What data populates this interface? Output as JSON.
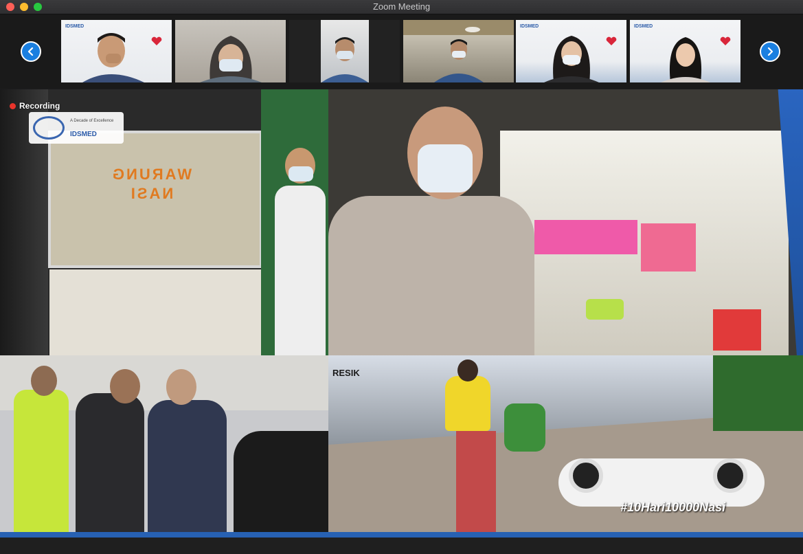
{
  "window": {
    "title": "Zoom Meeting"
  },
  "gallery": {
    "prev_icon": "chevron-left-icon",
    "next_icon": "chevron-right-icon",
    "thumbnails": [
      {
        "name": "participant-1",
        "logo": "IDSMED"
      },
      {
        "name": "participant-2",
        "logo": ""
      },
      {
        "name": "participant-3",
        "logo": ""
      },
      {
        "name": "participant-4",
        "logo": ""
      },
      {
        "name": "participant-5",
        "logo": "IDSMED"
      },
      {
        "name": "participant-6",
        "logo": "IDSMED"
      }
    ]
  },
  "share": {
    "recording_label": "Recording",
    "badge_tagline": "A Decade of Excellence",
    "badge_logo": "IDSMED",
    "hashtag": "#10Hari10000Nasi",
    "sign_text": "RESIK"
  },
  "colors": {
    "accent": "#1a7fe0",
    "brand_band": "#2761b3",
    "recording": "#e8342b"
  }
}
